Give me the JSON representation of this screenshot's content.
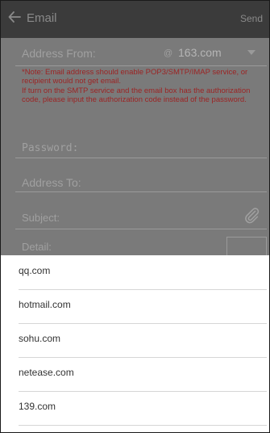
{
  "header": {
    "title": "Email",
    "send_label": "Send"
  },
  "form": {
    "address_from_label": "Address From:",
    "at_symbol": "@",
    "selected_domain": "163.com",
    "note1": "*Note: Email address should enable POP3/SMTP/IMAP service, or recipient would not get email.",
    "note2": "If turn on the SMTP service and the email box has the authorization code, please input the authorization code instead of the password.",
    "password_placeholder": "Password:",
    "address_to_placeholder": "Address To:",
    "subject_placeholder": "Subject:",
    "detail_placeholder": "Detail:"
  },
  "domain_options": [
    "qq.com",
    "hotmail.com",
    "sohu.com",
    "netease.com",
    "139.com"
  ],
  "colors": {
    "appbar": "#3b3b3b",
    "overlay": "#7a7a7a",
    "note": "#9c2424",
    "sheet": "#ffffff"
  },
  "icons": {
    "back": "arrow-left-icon",
    "attach": "paperclip-icon",
    "dropdown": "triangle-down-icon"
  }
}
